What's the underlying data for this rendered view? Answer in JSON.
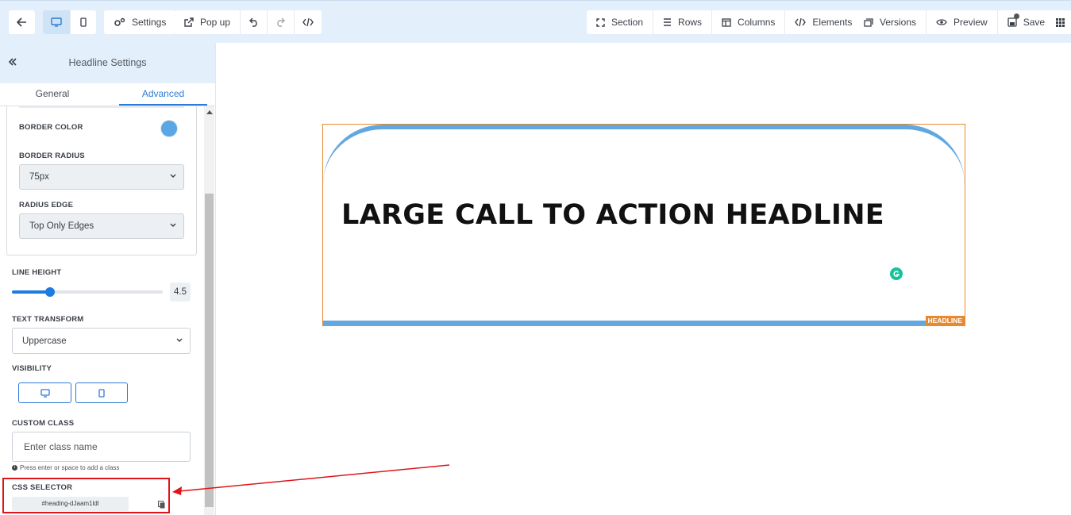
{
  "toolbar": {
    "left": {
      "settings_label": "Settings",
      "popup_label": "Pop up"
    },
    "structure": {
      "section_label": "Section",
      "rows_label": "Rows",
      "columns_label": "Columns",
      "elements_label": "Elements"
    },
    "actions": {
      "versions_label": "Versions",
      "preview_label": "Preview",
      "save_label": "Save"
    }
  },
  "panel": {
    "title": "Headline Settings",
    "tabs": [
      {
        "label": "General",
        "active": false
      },
      {
        "label": "Advanced",
        "active": true
      }
    ],
    "border_color": {
      "label": "BORDER COLOR",
      "value": "#5aa7e6"
    },
    "border_radius": {
      "label": "BORDER RADIUS",
      "value": "75px"
    },
    "radius_edge": {
      "label": "RADIUS EDGE",
      "value": "Top Only Edges"
    },
    "line_height": {
      "label": "LINE HEIGHT",
      "value": "4.5",
      "fraction": 0.25
    },
    "text_transform": {
      "label": "TEXT TRANSFORM",
      "value": "Uppercase"
    },
    "visibility": {
      "label": "VISIBILITY"
    },
    "custom_class": {
      "label": "CUSTOM CLASS",
      "placeholder": "Enter class name",
      "hint": "Press enter or space to add a class"
    },
    "css_selector": {
      "label": "CSS SELECTOR",
      "value": "#heading-dJaam1ldl"
    }
  },
  "canvas": {
    "headline_text": "LARGE CALL TO ACTION HEADLINE",
    "element_badge": "HEADLINE",
    "accent_color": "#62a8e0",
    "selection_color": "#e8892f"
  }
}
